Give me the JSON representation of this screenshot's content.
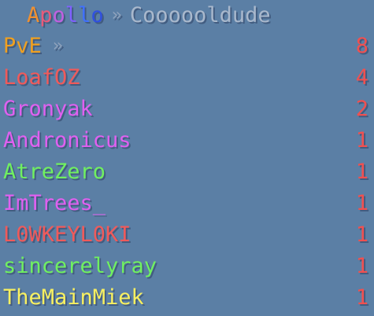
{
  "title": {
    "segments": [
      {
        "text": "A",
        "color": "#f09030"
      },
      {
        "text": "p",
        "color": "#e85a7a"
      },
      {
        "text": "o",
        "color": "#c060e0"
      },
      {
        "text": "l",
        "color": "#8060ff"
      },
      {
        "text": "l",
        "color": "#4070ff"
      },
      {
        "text": "o",
        "color": "#3050e0"
      }
    ],
    "separator": "»",
    "separator_color": "#8fa3bd",
    "player": "Coooooldude",
    "player_color": "#a9b8cc"
  },
  "rows": [
    {
      "name": "PvE",
      "score": "8",
      "color": "#f0a020",
      "score_color": "#f05050",
      "arrow": "»",
      "arrow_color": "#8fa3bd"
    },
    {
      "name": "LoafOZ",
      "score": "4",
      "color": "#f05a5a",
      "score_color": "#f05050"
    },
    {
      "name": "Gronyak",
      "score": "2",
      "color": "#e060f0",
      "score_color": "#f05050"
    },
    {
      "name": "Andronicus",
      "score": "1",
      "color": "#e060f0",
      "score_color": "#f05050"
    },
    {
      "name": "AtreZero",
      "score": "1",
      "color": "#70f060",
      "score_color": "#f05050"
    },
    {
      "name": "ImTrees_",
      "score": "1",
      "color": "#e060f0",
      "score_color": "#f05050"
    },
    {
      "name": "L0WKEYL0KI",
      "score": "1",
      "color": "#f05a5a",
      "score_color": "#f05050"
    },
    {
      "name": "sincerelyray",
      "score": "1",
      "color": "#70f060",
      "score_color": "#f05050"
    },
    {
      "name": "TheMainMiek",
      "score": "1",
      "color": "#f8f060",
      "score_color": "#f05050"
    }
  ]
}
